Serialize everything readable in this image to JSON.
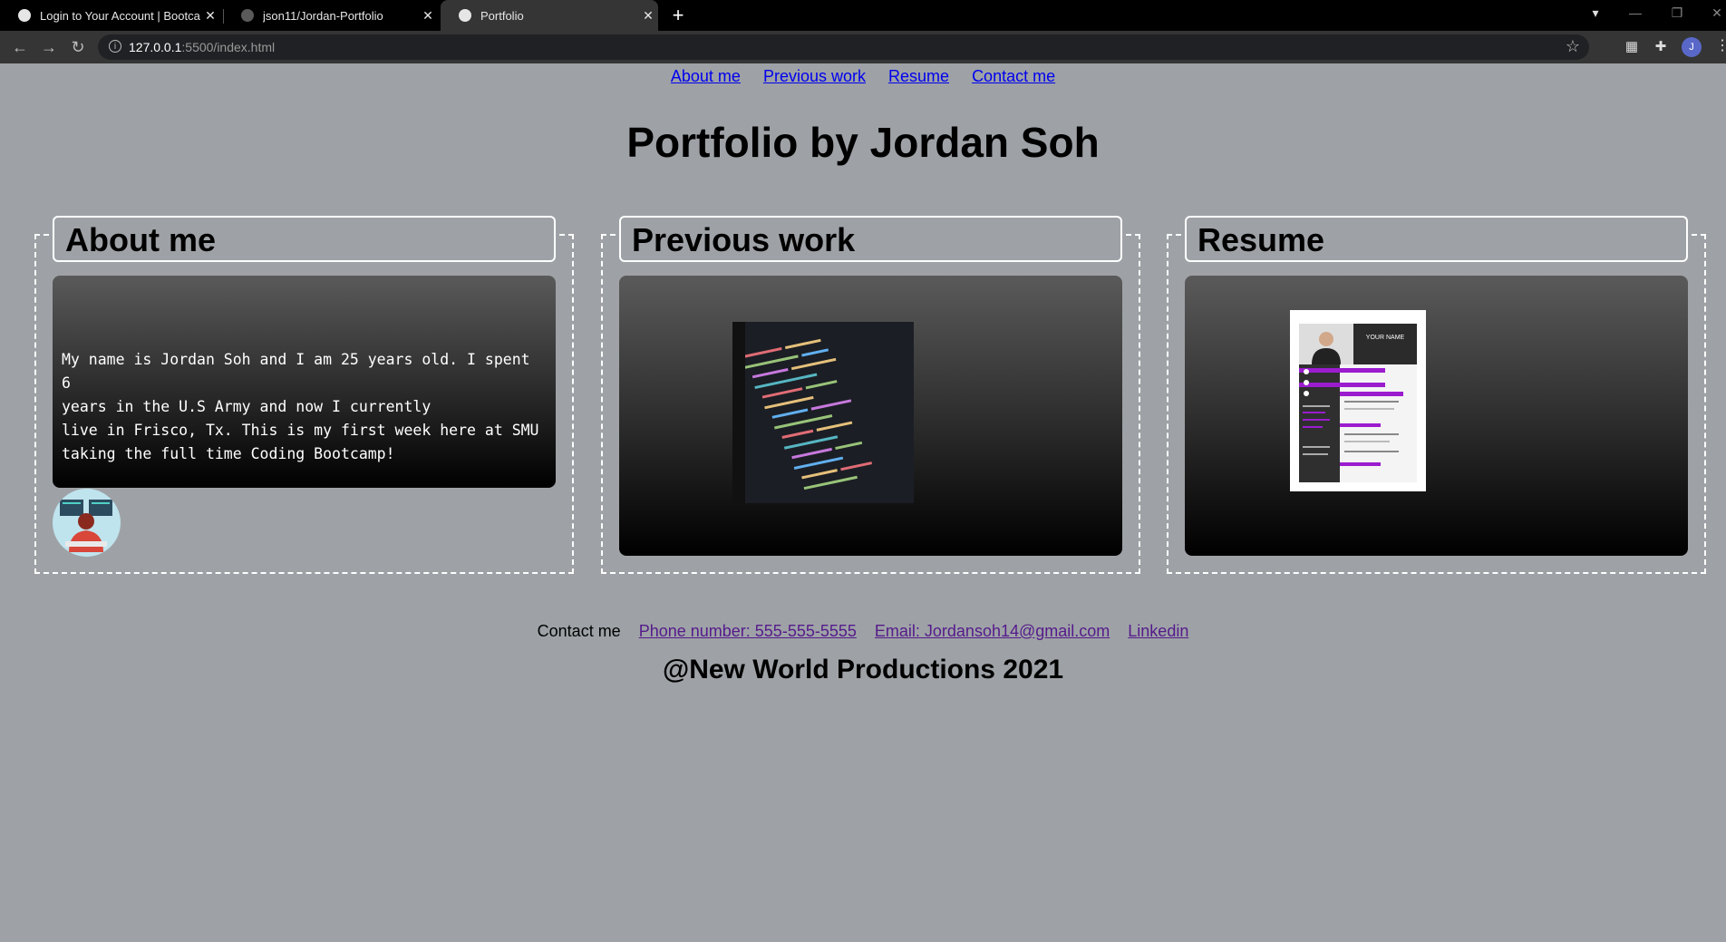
{
  "browser": {
    "tabs": [
      {
        "title": "Login to Your Account | Bootcamp"
      },
      {
        "title": "json11/Jordan-Portfolio"
      },
      {
        "title": "Portfolio"
      }
    ],
    "url_host": "127.0.0.1",
    "url_path": ":5500/index.html",
    "profile_initial": "J"
  },
  "nav": {
    "links": [
      "About me",
      "Previous work",
      "Resume",
      "Contact me"
    ]
  },
  "page": {
    "title": "Portfolio by Jordan Soh",
    "sections": [
      {
        "heading": "About me",
        "text": "My name is Jordan Soh and I am 25 years old. I spent 6\nyears in the U.S Army and now I currently\nlive in Frisco, Tx. This is my first week here at SMU\ntaking the full time Coding Bootcamp!"
      },
      {
        "heading": "Previous work"
      },
      {
        "heading": "Resume",
        "resume_image_text": "YOUR NAME"
      }
    ]
  },
  "footer": {
    "contact_label": "Contact me",
    "phone": "Phone number: 555-555-5555",
    "email": "Email: Jordansoh14@gmail.com",
    "linkedin": "Linkedin",
    "copyright": "@New World Productions 2021"
  }
}
